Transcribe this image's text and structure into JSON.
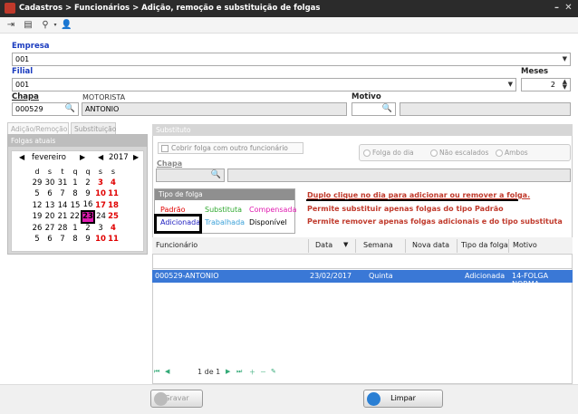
{
  "window": {
    "title": "Cadastros > Funcionários > Adição, remoção e substituição de folgas"
  },
  "toolbar": {
    "icons": [
      "exit-icon",
      "id-card-icon",
      "search-icon",
      "users-icon"
    ]
  },
  "empresa": {
    "label": "Empresa",
    "value": "001"
  },
  "filial": {
    "label": "Filial",
    "value": "001"
  },
  "meses": {
    "label": "Meses",
    "value": "2"
  },
  "chapa": {
    "label": "Chapa",
    "value": "000529"
  },
  "funcao": {
    "value": "MOTORISTA"
  },
  "nome": {
    "value": "ANTONIO"
  },
  "motivo": {
    "label": "Motivo",
    "value": ""
  },
  "tabs": {
    "adicao": "Adição/Remoção",
    "substituicao": "Substituição"
  },
  "folgas_atuais": {
    "label": "Folgas atuais"
  },
  "calendar": {
    "month": "fevereiro",
    "year": "2017",
    "weekdays": [
      "d",
      "s",
      "t",
      "q",
      "q",
      "s",
      "s"
    ],
    "weeks": [
      [
        "29",
        "30",
        "31",
        "1",
        "2",
        "3",
        "4"
      ],
      [
        "5",
        "6",
        "7",
        "8",
        "9",
        "10",
        "11"
      ],
      [
        "12",
        "13",
        "14",
        "15",
        "16",
        "17",
        "18"
      ],
      [
        "19",
        "20",
        "21",
        "22",
        "23",
        "24",
        "25"
      ],
      [
        "26",
        "27",
        "28",
        "1",
        "2",
        "3",
        "4"
      ],
      [
        "5",
        "6",
        "7",
        "8",
        "9",
        "10",
        "11"
      ]
    ],
    "selected": "23",
    "colors": {
      "weekend": "#e00000",
      "selected_bg": "#e01ab0"
    }
  },
  "substituto": {
    "header": "Substituto",
    "cobrir_label": "Cobrir folga com outro funcionário",
    "chapa_label": "Chapa",
    "options": [
      "Folga do dia",
      "Não escalados",
      "Ambos"
    ]
  },
  "tipo_folga": {
    "header": "Tipo de folga",
    "items": [
      {
        "label": "Padrão",
        "color": "#e00000"
      },
      {
        "label": "Substituta",
        "color": "#2ea82e"
      },
      {
        "label": "Compensada",
        "color": "#e01ab0"
      },
      {
        "label": "Adicionada",
        "color": "#1a1abf"
      },
      {
        "label": "Trabalhada",
        "color": "#3aa0d8"
      },
      {
        "label": "Disponível",
        "color": "#000000"
      }
    ]
  },
  "instructions": {
    "line1": "Duplo clique no dia para adicionar ou remover a folga.",
    "line2": "Permite substituir apenas folgas do tipo Padrão",
    "line3": "Permite remover apenas folgas adicionais e do tipo substituta"
  },
  "grid": {
    "columns": [
      "Funcionário",
      "Data",
      "Semana",
      "Nova data",
      "Tipo da folga",
      "Motivo"
    ],
    "rows": [
      [
        "000529-ANTONIO",
        "23/02/2017",
        "Quinta",
        "",
        "Adicionada",
        "14-FOLGA NORMA"
      ]
    ]
  },
  "pager": {
    "label": "1 de 1"
  },
  "buttons": {
    "gravar": "Gravar",
    "limpar": "Limpar"
  }
}
